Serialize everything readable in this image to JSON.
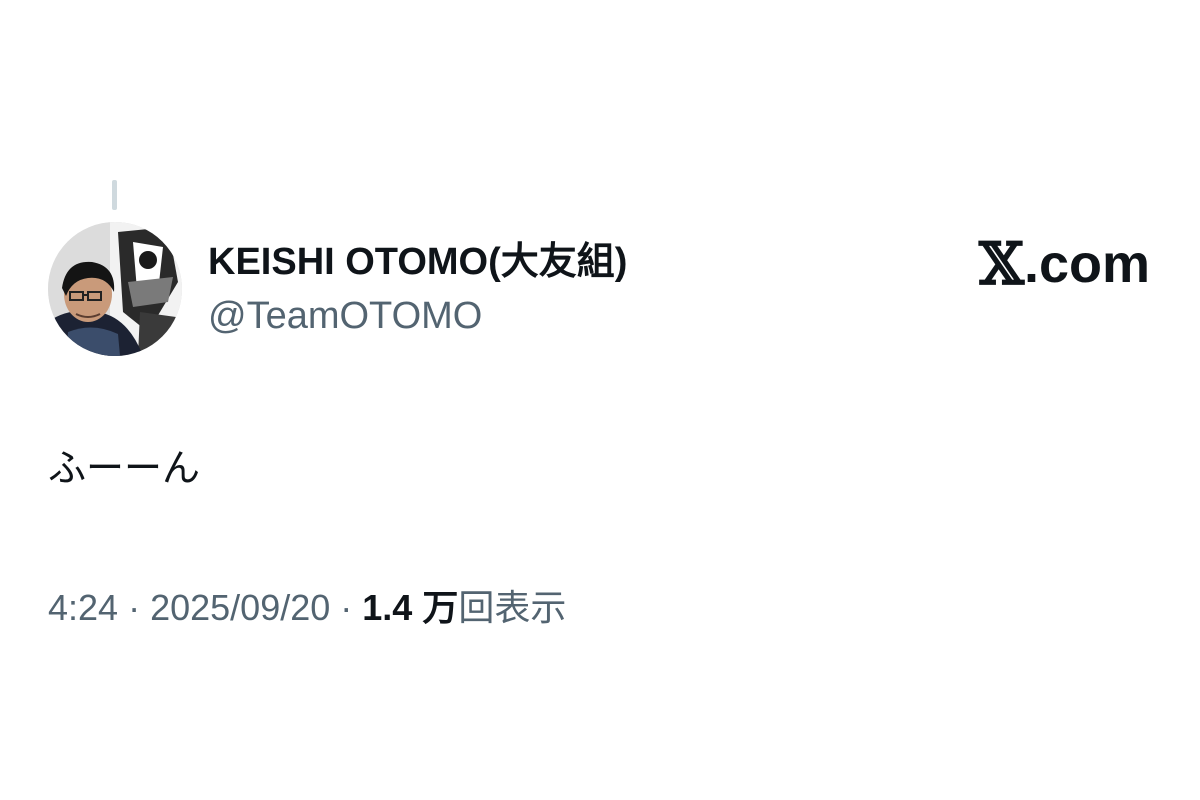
{
  "author": {
    "display_name": "KEISHI OTOMO(大友組)",
    "handle": "@TeamOTOMO",
    "avatar_icon": "avatar-photo"
  },
  "brand": {
    "x_glyph": "𝕏",
    "suffix": ".com"
  },
  "tweet": {
    "text": "ふーーん"
  },
  "meta": {
    "time": "4:24",
    "date": "2025/09/20",
    "separator": "·",
    "views_count": "1.4 万",
    "views_label": "回表示"
  },
  "colors": {
    "text_primary": "#0f1419",
    "text_secondary": "#536471",
    "thread_line": "#cfd9de",
    "background": "#ffffff"
  }
}
